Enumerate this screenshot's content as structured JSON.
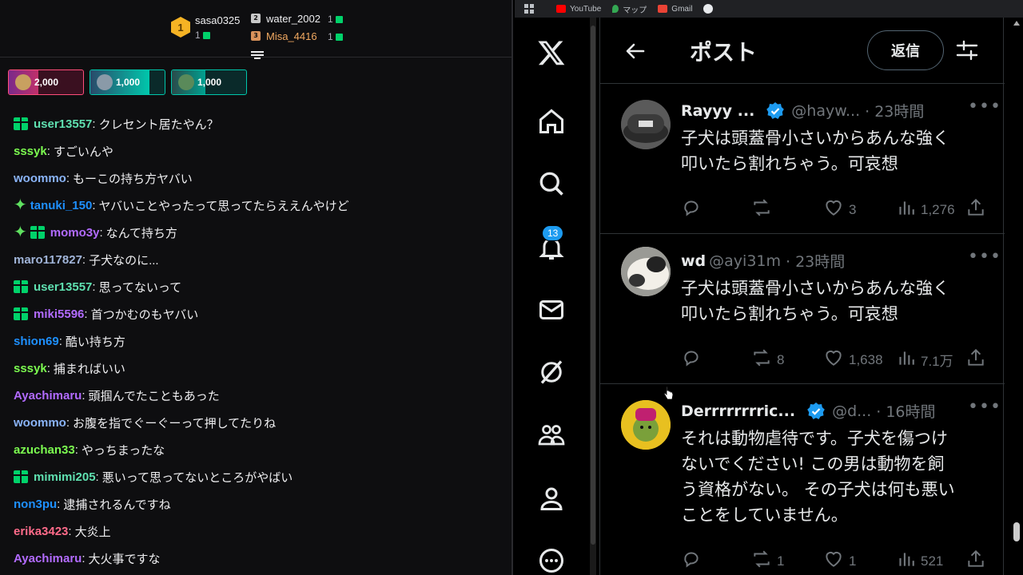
{
  "leaderboard": {
    "first": {
      "rank": "1",
      "name": "sasa0325",
      "count": "1"
    },
    "second": {
      "rank": "2",
      "name": "water_2002",
      "count": "1"
    },
    "third": {
      "rank": "3",
      "name": "Misa_4416",
      "count": "1"
    }
  },
  "bits": [
    {
      "value": "2,000",
      "color": "#eb0400"
    },
    {
      "value": "1,000",
      "color": "#00c7ac"
    },
    {
      "value": "1,000",
      "color": "#00c7ac"
    }
  ],
  "chat": [
    {
      "badges": [
        "gift"
      ],
      "user": "user13557",
      "color": "#5fe0b0",
      "text": "クレセント居たやん？"
    },
    {
      "badges": [],
      "user": "sssyk",
      "color": "#7cfc50",
      "text": "すごいんや"
    },
    {
      "badges": [],
      "user": "woommo",
      "color": "#8ab4f8",
      "text": "もーこの持ち方ヤバい"
    },
    {
      "badges": [
        "star"
      ],
      "user": "tanuki_150",
      "color": "#1e90ff",
      "text": "ヤバいことやったって思ってたらええんやけど"
    },
    {
      "badges": [
        "star",
        "gift"
      ],
      "user": "momo3y",
      "color": "#b26bff",
      "text": "なんて持ち方"
    },
    {
      "badges": [],
      "user": "maro117827",
      "color": "#a0b4d8",
      "text": "子犬なのに..."
    },
    {
      "badges": [
        "gift"
      ],
      "user": "user13557",
      "color": "#5fe0b0",
      "text": "思ってないって"
    },
    {
      "badges": [
        "gift"
      ],
      "user": "miki5596",
      "color": "#b26bff",
      "text": "首つかむのもヤバい"
    },
    {
      "badges": [],
      "user": "shion69",
      "color": "#1e90ff",
      "text": "酷い持ち方"
    },
    {
      "badges": [],
      "user": "sssyk",
      "color": "#7cfc50",
      "text": "捕まればいい"
    },
    {
      "badges": [],
      "user": "Ayachimaru",
      "color": "#b26bff",
      "text": "頭掴んでたこともあった"
    },
    {
      "badges": [],
      "user": "woommo",
      "color": "#8ab4f8",
      "text": "お腹を指でぐーぐーって押してたりね"
    },
    {
      "badges": [],
      "user": "azuchan33",
      "color": "#7cfc50",
      "text": "やっちまったな"
    },
    {
      "badges": [
        "gift"
      ],
      "user": "mimimi205",
      "color": "#5fe0b0",
      "text": "悪いって思ってないところがやばい"
    },
    {
      "badges": [],
      "user": "non3pu",
      "color": "#1e90ff",
      "text": "逮捕されるんですね"
    },
    {
      "badges": [],
      "user": "erika3423",
      "color": "#ff6b8a",
      "text": "大炎上"
    },
    {
      "badges": [],
      "user": "Ayachimaru",
      "color": "#b26bff",
      "text": "大火事ですな"
    }
  ],
  "bookmarks": [
    {
      "label": "YouTube",
      "color": "#ff0000"
    },
    {
      "label": "マップ",
      "color": "#34a853"
    },
    {
      "label": "Gmail",
      "color": "#ea4335"
    }
  ],
  "x": {
    "notifications_count": "13",
    "header": {
      "title": "ポスト",
      "reply_button": "返信"
    },
    "tweets": [
      {
        "name": "Rayyy ...",
        "verified": true,
        "handle": "@hayw...",
        "time": "· 23時間",
        "text_line1": "子犬は頭蓋骨小さいからあんな強く",
        "text_line2": "叩いたら割れちゃう。可哀想",
        "text_line3": "",
        "text_line4": "",
        "retweets": "",
        "likes": "3",
        "views": "1,276"
      },
      {
        "name": "wd",
        "verified": false,
        "handle": "@ayi31m",
        "time": "· 23時間",
        "text_line1": "子犬は頭蓋骨小さいからあんな強く",
        "text_line2": "叩いたら割れちゃう。可哀想",
        "text_line3": "",
        "text_line4": "",
        "retweets": "8",
        "likes": "1,638",
        "views": "7.1万"
      },
      {
        "name": "Derrrrrrrric...",
        "verified": true,
        "handle": "@d...",
        "time": "· 16時間",
        "text_line1": "それは動物虐待です。子犬を傷つけ",
        "text_line2": "ないでください! この男は動物を飼",
        "text_line3": "う資格がない。 その子犬は何も悪い",
        "text_line4": "ことをしていません。",
        "retweets": "1",
        "likes": "1",
        "views": "521"
      }
    ]
  }
}
